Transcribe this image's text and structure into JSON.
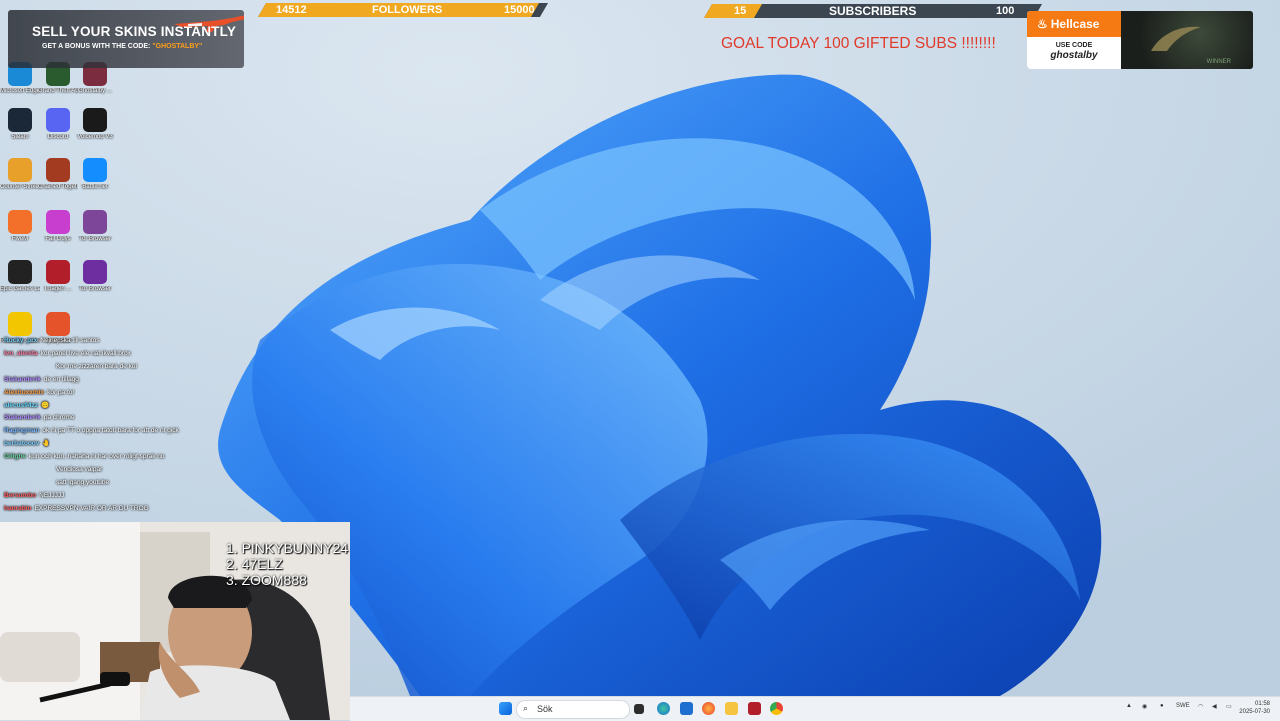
{
  "desktop_icons": [
    {
      "label": "Microsoft Edge",
      "icon": "edge-icon",
      "color": "#1b8ad6"
    },
    {
      "label": "Grand Theft Auto V",
      "icon": "gta-icon",
      "color": "#2a5b2e"
    },
    {
      "label": "Ghostalby ...",
      "icon": "ghostalby-icon",
      "color": "#7b2c3f"
    },
    {
      "label": "Steam",
      "icon": "steam-icon",
      "color": "#1b2838"
    },
    {
      "label": "Discord",
      "icon": "discord-icon",
      "color": "#5865f2"
    },
    {
      "label": "Voicemod V3",
      "icon": "voicemod-icon",
      "color": "#1a1a1a"
    },
    {
      "label": "Counter-Strike 2",
      "icon": "cs2-icon",
      "color": "#e8a02a"
    },
    {
      "label": "Chained Together",
      "icon": "chained-icon",
      "color": "#a33b20"
    },
    {
      "label": "Battle.net",
      "icon": "battlenet-icon",
      "color": "#148eff"
    },
    {
      "label": "FiveM",
      "icon": "fivem-icon",
      "color": "#f3702a"
    },
    {
      "label": "Fall Guys",
      "icon": "fallguys-icon",
      "color": "#c83fd0"
    },
    {
      "label": "Tor Browser",
      "icon": "tor-icon",
      "color": "#7d4698"
    },
    {
      "label": "Epic Games Launcher",
      "icon": "epic-icon",
      "color": "#222222"
    },
    {
      "label": "Imagen ...",
      "icon": "imagen-icon",
      "color": "#b21e2a"
    },
    {
      "label": "Tor Browser",
      "icon": "tor-browser-icon",
      "color": "#6e2ea0"
    },
    {
      "label": "Rockstar Games",
      "icon": "rockstar-icon",
      "color": "#f2c600"
    },
    {
      "label": "Microsoft",
      "icon": "office-icon",
      "color": "#e4532a"
    }
  ],
  "skins_banner": {
    "title": "SELL YOUR SKINS INSTANTLY",
    "subtitle_prefix": "GET A BONUS WITH THE CODE: ",
    "code": "\"GHOSTALBY\""
  },
  "followers_bar": {
    "current": "14512",
    "label": "FOLLOWERS",
    "goal": "15000",
    "progress": 0.9676
  },
  "subscribers_bar": {
    "current": "15",
    "label": "SUBSCRIBERS",
    "goal": "100",
    "progress": 0.15
  },
  "goal_text": "GOAL TODAY 100 GIFTED SUBS !!!!!!!!",
  "hellcase": {
    "brand": "Hellcase",
    "use_code": "USE CODE",
    "code": "ghostalby",
    "winner": "WINNER"
  },
  "chat": [
    {
      "user": "Rocky_prx",
      "msg": "Nejnej ska till santos",
      "color": "#6fd0ff"
    },
    {
      "user": "Ivo_alenita",
      "msg": "kor panel live ele nat ikvall brox",
      "color": "#ff7aa2"
    },
    {
      "user": "",
      "msg": "Kor me zizzaren bara de kul",
      "color": "#ffffff"
    },
    {
      "user": "Stakanderik",
      "msg": "de en tillagg",
      "color": "#b08cff"
    },
    {
      "user": "Alexhuxxmix",
      "msg": "kor pa tor",
      "color": "#ff9a3c"
    },
    {
      "user": "alecus94zz",
      "msg": "🙃",
      "color": "#5fd7ff"
    },
    {
      "user": "Stakanderik",
      "msg": "pa chrome",
      "color": "#b08cff"
    },
    {
      "user": "Ragingman",
      "msg": "ok ni pa TT o oppna tatoti bara for att de nt gick",
      "color": "#7ab8ff"
    },
    {
      "user": "berbatooov",
      "msg": "🤚",
      "color": "#7ad0ff"
    },
    {
      "user": "Gilighe",
      "msg": "kuri och kuri, hahaha ni har over roligt sprak nu",
      "color": "#6ad1a0"
    },
    {
      "user": "",
      "msg": "Vendiosa valpar",
      "color": "#ffffff"
    },
    {
      "user": "",
      "msg": "satt igang youtube",
      "color": "#ffffff"
    },
    {
      "user": "Bersumbo",
      "msg": "NEJJJJJ",
      "color": "#ff5b5b"
    },
    {
      "user": "hanrabin",
      "msg": "EXPRESSVPN VAIR OR AR DU TROG",
      "color": "#ff5b5b"
    }
  ],
  "leaderboard": [
    "1. PINKYBUNNY24",
    "2. 47ELZ",
    "3. ZOOM888"
  ],
  "taskbar": {
    "search_placeholder": "Sök",
    "language": "SWE",
    "time": "01:58",
    "date": "2025-07-30"
  }
}
